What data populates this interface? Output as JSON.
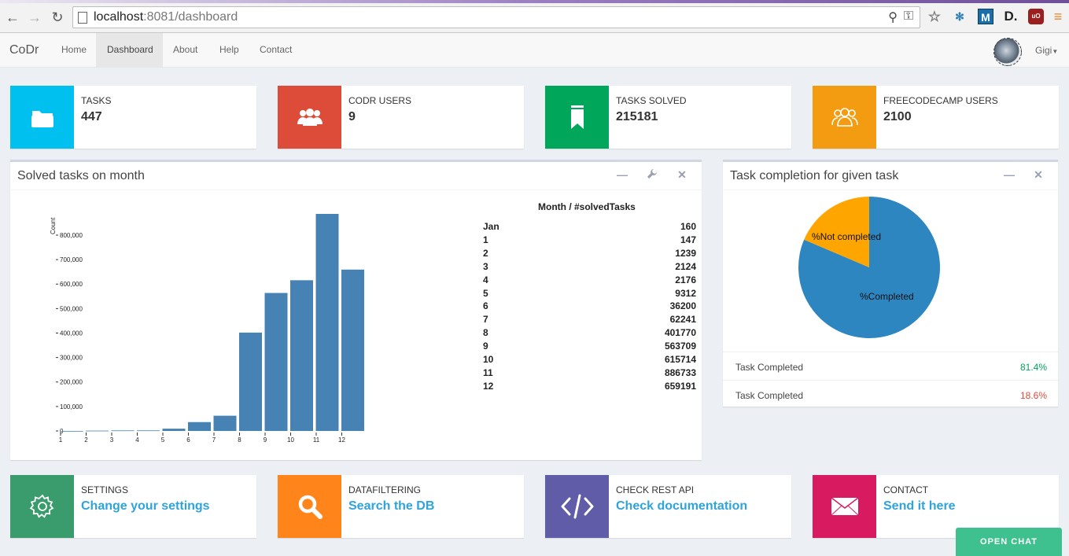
{
  "browser": {
    "url_host": "localhost",
    "url_path": ":8081/dashboard"
  },
  "navbar": {
    "brand": "CoDr",
    "items": [
      {
        "label": "Home"
      },
      {
        "label": "Dashboard",
        "active": true
      },
      {
        "label": "About"
      },
      {
        "label": "Help"
      },
      {
        "label": "Contact"
      }
    ],
    "user": "Gigi"
  },
  "stats": [
    {
      "label": "TASKS",
      "value": "447",
      "color": "#00c0ef",
      "icon": "folder-icon"
    },
    {
      "label": "CODR USERS",
      "value": "9",
      "color": "#dd4b39",
      "icon": "users-icon"
    },
    {
      "label": "TASKS SOLVED",
      "value": "215181",
      "color": "#00a65a",
      "icon": "bookmark-icon"
    },
    {
      "label": "FREECODECAMP USERS",
      "value": "2100",
      "color": "#f39c12",
      "icon": "group-outline-icon"
    }
  ],
  "solved_panel": {
    "title": "Solved tasks on month",
    "y_axis_label": "Count",
    "table_header": "Month / #solvedTasks",
    "rows": [
      {
        "month": "Jan",
        "value": "160"
      },
      {
        "month": "1",
        "value": "147"
      },
      {
        "month": "2",
        "value": "1239"
      },
      {
        "month": "3",
        "value": "2124"
      },
      {
        "month": "4",
        "value": "2176"
      },
      {
        "month": "5",
        "value": "9312"
      },
      {
        "month": "6",
        "value": "36200"
      },
      {
        "month": "7",
        "value": "62241"
      },
      {
        "month": "8",
        "value": "401770"
      },
      {
        "month": "9",
        "value": "563709"
      },
      {
        "month": "10",
        "value": "615714"
      },
      {
        "month": "11",
        "value": "886733"
      },
      {
        "month": "12",
        "value": "659191"
      }
    ]
  },
  "chart_data": {
    "type": "bar",
    "categories": [
      "1",
      "2",
      "3",
      "4",
      "5",
      "6",
      "7",
      "8",
      "9",
      "10",
      "11",
      "12"
    ],
    "values": [
      147,
      1239,
      2124,
      2176,
      9312,
      36200,
      62241,
      401770,
      563709,
      615714,
      886733,
      659191
    ],
    "ylabel": "Count",
    "yticks": [
      0,
      100000,
      200000,
      300000,
      400000,
      500000,
      600000,
      700000,
      800000
    ],
    "ytick_labels": [
      "0",
      "100,000",
      "200,000",
      "300,000",
      "400,000",
      "500,000",
      "600,000",
      "700,000",
      "800,000"
    ],
    "ylim": [
      0,
      886733
    ],
    "color": "#4682b4"
  },
  "completion_panel": {
    "title": "Task completion for given task",
    "pie": [
      {
        "label": "%Completed",
        "value": 81.4,
        "color": "#2e86c1"
      },
      {
        "label": "%Not completed",
        "value": 18.6,
        "color": "#ffa500"
      }
    ],
    "rows": [
      {
        "label": "Task Completed",
        "pct": "81.4%",
        "color": "#00a65a"
      },
      {
        "label": "Task Completed",
        "pct": "18.6%",
        "color": "#dd4b39"
      }
    ]
  },
  "actions": [
    {
      "label": "SETTINGS",
      "link": "Change your settings",
      "color": "#3a9c6c",
      "icon": "gear-icon"
    },
    {
      "label": "DATAFILTERING",
      "link": "Search the DB",
      "color": "#ff851b",
      "icon": "search-icon"
    },
    {
      "label": "CHECK REST API",
      "link": "Check documentation",
      "color": "#605ca8",
      "icon": "code-icon"
    },
    {
      "label": "CONTACT",
      "link": "Send it here",
      "color": "#d81b60",
      "icon": "envelope-icon"
    }
  ],
  "chat_button": "OPEN CHAT"
}
